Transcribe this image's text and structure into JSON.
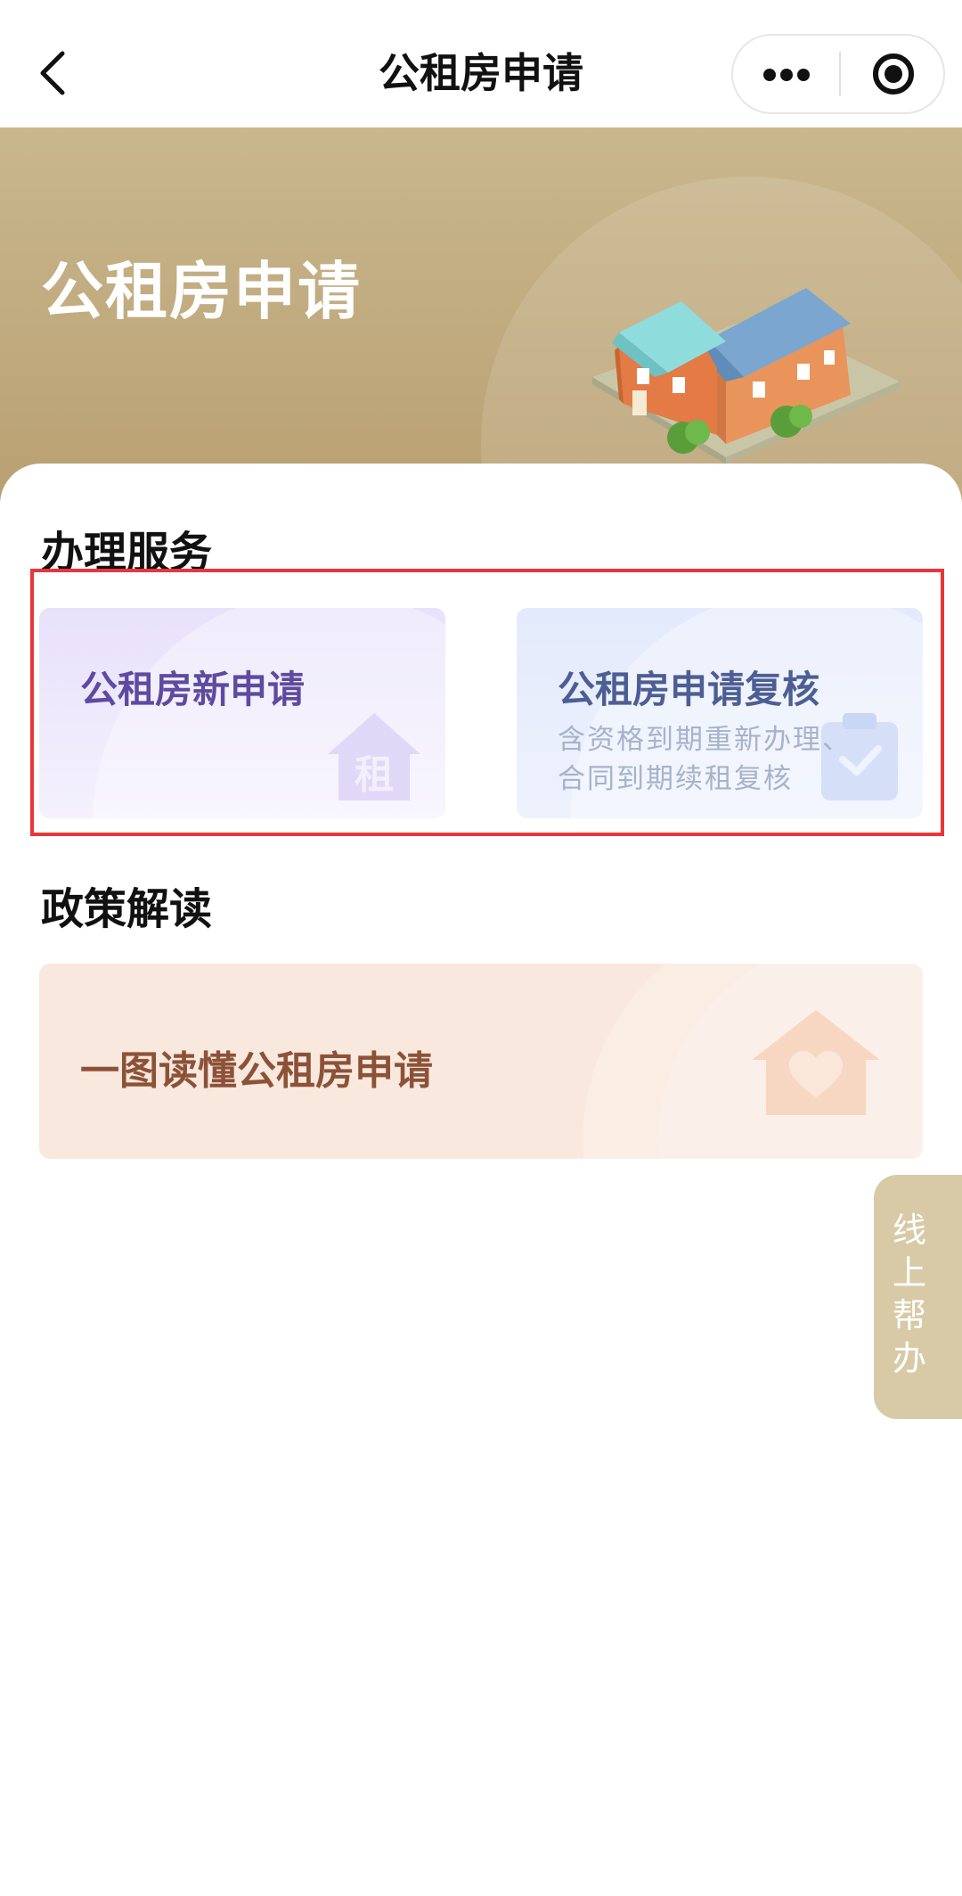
{
  "nav": {
    "title": "公租房申请",
    "back_icon": "chevron-left-icon",
    "more_icon": "more-dots-icon",
    "close_icon": "target-close-icon"
  },
  "banner": {
    "title": "公租房申请",
    "illustration": "house-illustration"
  },
  "services": {
    "heading": "办理服务",
    "cards": [
      {
        "title": "公租房新申请",
        "icon": "house-rent-icon",
        "icon_text": "租"
      },
      {
        "title": "公租房申请复核",
        "subtitle_line1": "含资格到期重新办理、",
        "subtitle_line2": "合同到期续租复核",
        "icon": "clipboard-check-icon"
      }
    ]
  },
  "policy": {
    "heading": "政策解读",
    "card_title": "一图读懂公租房申请",
    "icon": "house-heart-icon"
  },
  "float_help": {
    "chars": [
      "线",
      "上",
      "帮",
      "办"
    ]
  },
  "colors": {
    "banner": "#c4af85",
    "highlight_border": "#e8363a",
    "new_card_title": "#5e4aa0",
    "review_card_title": "#4d5e94",
    "policy_title": "#8c5238",
    "help_button": "#d8caa6"
  }
}
